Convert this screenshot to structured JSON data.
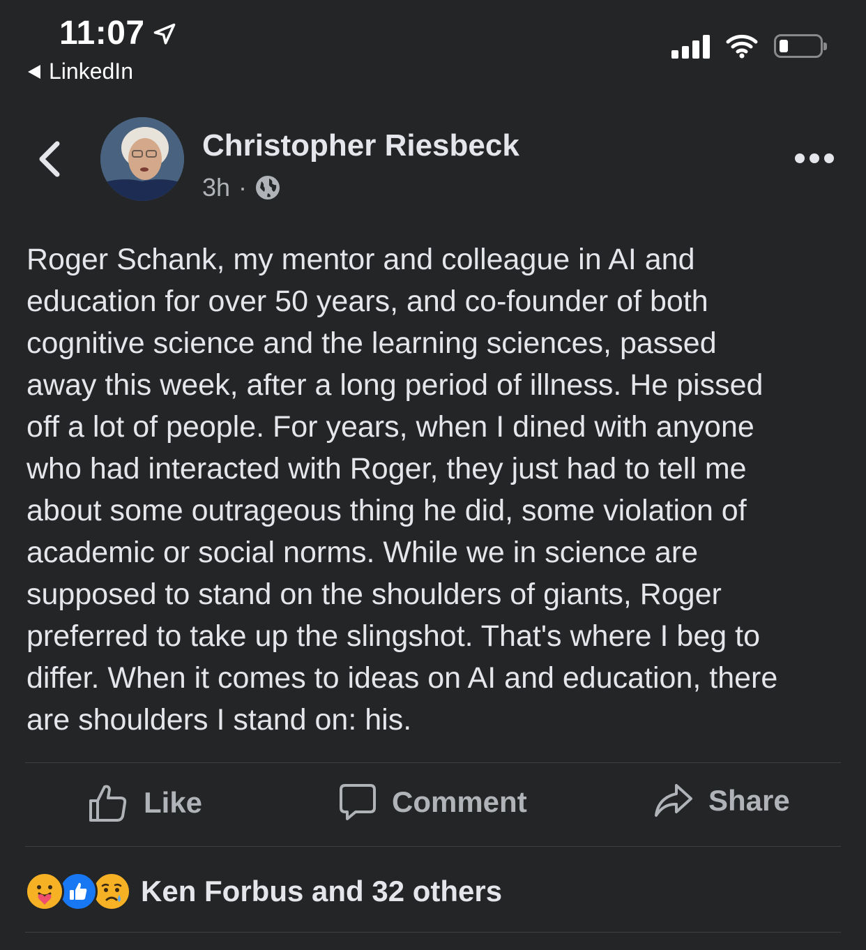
{
  "status_bar": {
    "time": "11:07",
    "back_app_label": "LinkedIn"
  },
  "post": {
    "author": "Christopher Riesbeck",
    "timestamp": "3h",
    "separator": "·",
    "lines": [
      "Roger Schank, my mentor and colleague in AI and",
      "education for over 50 years, and co-founder of both",
      "cognitive science and the learning sciences, passed",
      "away this week, after a long period of illness. He pissed",
      "off a lot of people. For years, when I dined with anyone",
      "who had interacted with Roger, they just had to tell me",
      "about some outrageous thing he did, some violation of",
      "academic or social norms. While we in science are",
      "supposed to stand on the shoulders of giants, Roger",
      "preferred to take up the slingshot. That's where I beg to",
      "differ. When it comes to ideas on AI and education, there",
      "are shoulders I stand on: his."
    ]
  },
  "actions": {
    "like": "Like",
    "comment": "Comment",
    "share": "Share"
  },
  "reactions": {
    "summary": "Ken Forbus and 32 others",
    "icons": [
      "care-reaction-icon",
      "like-reaction-icon",
      "sad-reaction-icon"
    ]
  },
  "colors": {
    "background": "#242526",
    "primary_text": "#e4e6eb",
    "secondary_text": "#b0b3b8",
    "like_blue": "#1877f2",
    "reaction_yellow": "#f7b125"
  }
}
